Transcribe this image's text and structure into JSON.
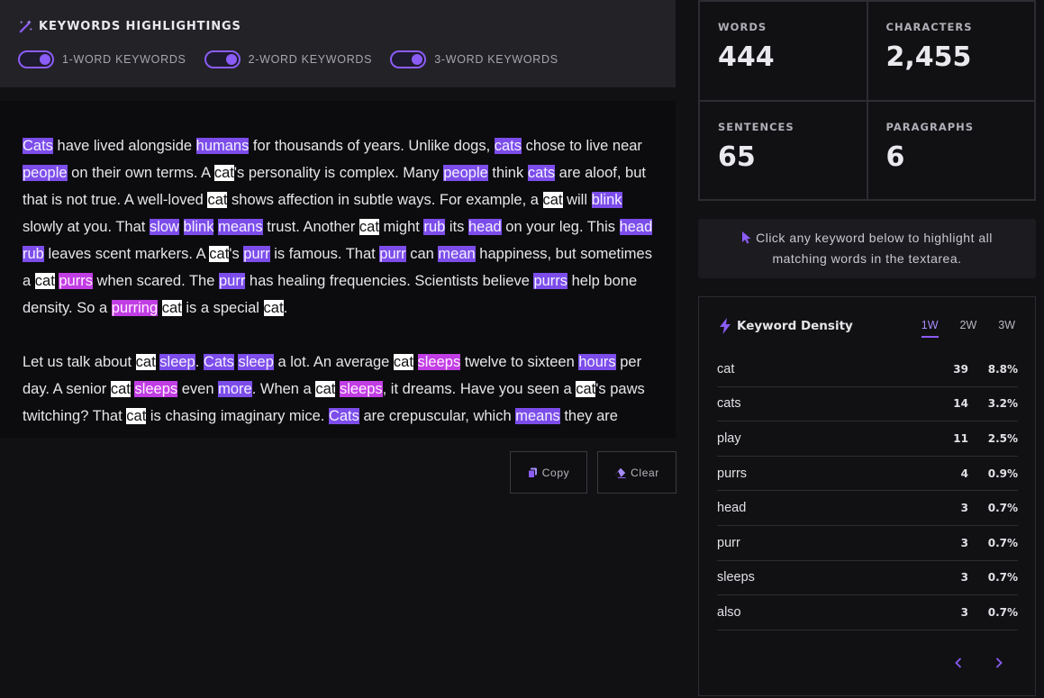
{
  "header": {
    "title": "KEYWORDS HIGHLIGHTINGS",
    "toggles": [
      {
        "label": "1-WORD KEYWORDS",
        "on": true
      },
      {
        "label": "2-WORD KEYWORDS",
        "on": true
      },
      {
        "label": "3-WORD KEYWORDS",
        "on": true
      }
    ]
  },
  "text": {
    "paragraphs": [
      [
        [
          "Cats",
          "w1"
        ],
        [
          " have lived alongside ",
          ""
        ],
        [
          "humans",
          "w1"
        ],
        [
          " for thousands of years. Unlike dogs, ",
          ""
        ],
        [
          "cats",
          "w1"
        ],
        [
          " chose to live near ",
          ""
        ],
        [
          "people",
          "w1"
        ],
        [
          " on their own terms. A ",
          ""
        ],
        [
          "cat",
          "w3"
        ],
        [
          "'s personality is complex. Many ",
          ""
        ],
        [
          "people",
          "w1"
        ],
        [
          " think ",
          ""
        ],
        [
          "cats",
          "w1"
        ],
        [
          " are aloof, but that is not true. A well-loved ",
          ""
        ],
        [
          "cat",
          "w3"
        ],
        [
          " shows affection in subtle ways. For example, a ",
          ""
        ],
        [
          "cat",
          "w3"
        ],
        [
          " will ",
          ""
        ],
        [
          "blink",
          "w1"
        ],
        [
          " slowly at you. That ",
          ""
        ],
        [
          "slow",
          "w1"
        ],
        [
          " ",
          ""
        ],
        [
          "blink",
          "w1"
        ],
        [
          " ",
          ""
        ],
        [
          "means",
          "w1"
        ],
        [
          " trust. Another ",
          ""
        ],
        [
          "cat",
          "w3"
        ],
        [
          " might ",
          ""
        ],
        [
          "rub",
          "w1"
        ],
        [
          " its ",
          ""
        ],
        [
          "head",
          "w1"
        ],
        [
          " on your leg. This ",
          ""
        ],
        [
          "head",
          "w1"
        ],
        [
          " ",
          ""
        ],
        [
          "rub",
          "w1"
        ],
        [
          " leaves scent markers. A ",
          ""
        ],
        [
          "cat",
          "w3"
        ],
        [
          "'s ",
          ""
        ],
        [
          "purr",
          "w1"
        ],
        [
          " is famous. That ",
          ""
        ],
        [
          "purr",
          "w1"
        ],
        [
          " can ",
          ""
        ],
        [
          "mean",
          "w1"
        ],
        [
          " happiness, but sometimes a ",
          ""
        ],
        [
          "cat",
          "w3"
        ],
        [
          " ",
          ""
        ],
        [
          "purrs",
          "w2"
        ],
        [
          " when scared. The ",
          ""
        ],
        [
          "purr",
          "w1"
        ],
        [
          " has healing frequencies. Scientists believe ",
          ""
        ],
        [
          "purrs",
          "w1"
        ],
        [
          " help bone density. So a ",
          ""
        ],
        [
          "purring",
          "w2"
        ],
        [
          " ",
          ""
        ],
        [
          "cat",
          "w3"
        ],
        [
          " is a special ",
          ""
        ],
        [
          "cat",
          "w3"
        ],
        [
          ".",
          ""
        ]
      ],
      [
        [
          "Let us talk about ",
          ""
        ],
        [
          "cat",
          "w3"
        ],
        [
          " ",
          ""
        ],
        [
          "sleep",
          "w1"
        ],
        [
          ". ",
          ""
        ],
        [
          "Cats",
          "w1"
        ],
        [
          " ",
          ""
        ],
        [
          "sleep",
          "w1"
        ],
        [
          " a lot. An average ",
          ""
        ],
        [
          "cat",
          "w3"
        ],
        [
          " ",
          ""
        ],
        [
          "sleeps",
          "w2"
        ],
        [
          " twelve to sixteen ",
          ""
        ],
        [
          "hours",
          "w1"
        ],
        [
          " per day. A senior ",
          ""
        ],
        [
          "cat",
          "w3"
        ],
        [
          " ",
          ""
        ],
        [
          "sleeps",
          "w2"
        ],
        [
          " even ",
          ""
        ],
        [
          "more",
          "w1"
        ],
        [
          ". When a ",
          ""
        ],
        [
          "cat",
          "w3"
        ],
        [
          " ",
          ""
        ],
        [
          "sleeps",
          "w2"
        ],
        [
          ", it dreams. Have you seen a ",
          ""
        ],
        [
          "cat",
          "w3"
        ],
        [
          "'s paws twitching? That ",
          ""
        ],
        [
          "cat",
          "w3"
        ],
        [
          " is chasing imaginary mice. ",
          ""
        ],
        [
          "Cats",
          "w1"
        ],
        [
          " are crepuscular, which ",
          ""
        ],
        [
          "means",
          "w1"
        ],
        [
          " they are",
          ""
        ]
      ]
    ]
  },
  "actions": {
    "copy_label": "Copy",
    "clear_label": "Clear"
  },
  "stats": [
    {
      "label": "WORDS",
      "value": "444"
    },
    {
      "label": "CHARACTERS",
      "value": "2,455"
    },
    {
      "label": "SENTENCES",
      "value": "65"
    },
    {
      "label": "PARAGRAPHS",
      "value": "6"
    }
  ],
  "hint": {
    "line1": "Click any keyword below to highlight all",
    "line2": "matching words in the textarea."
  },
  "density": {
    "title": "Keyword Density",
    "tabs": [
      {
        "label": "1W",
        "active": true
      },
      {
        "label": "2W",
        "active": false
      },
      {
        "label": "3W",
        "active": false
      }
    ],
    "rows": [
      {
        "word": "cat",
        "count": "39",
        "pct": "8.8%"
      },
      {
        "word": "cats",
        "count": "14",
        "pct": "3.2%"
      },
      {
        "word": "play",
        "count": "11",
        "pct": "2.5%"
      },
      {
        "word": "purrs",
        "count": "4",
        "pct": "0.9%"
      },
      {
        "word": "head",
        "count": "3",
        "pct": "0.7%"
      },
      {
        "word": "purr",
        "count": "3",
        "pct": "0.7%"
      },
      {
        "word": "sleeps",
        "count": "3",
        "pct": "0.7%"
      },
      {
        "word": "also",
        "count": "3",
        "pct": "0.7%"
      }
    ],
    "pager": {
      "prev_icon": "chevron-left-icon",
      "next_icon": "chevron-right-icon"
    }
  },
  "colors": {
    "accent": "#8b5cf6",
    "one_word": "#7c4dea",
    "two_word": "#c13de4",
    "three_word": "#ffffff"
  }
}
